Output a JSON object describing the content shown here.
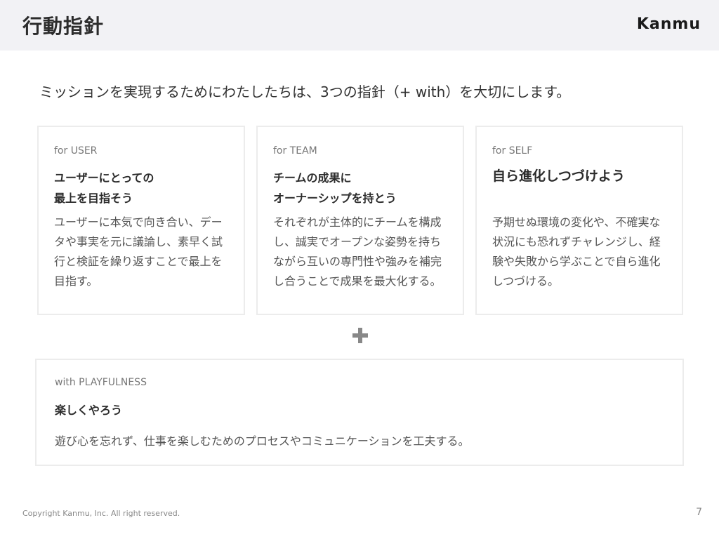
{
  "header": {
    "title": "行動指針",
    "logo": "Kanmu"
  },
  "intro": "ミッションを実現するためにわたしたちは、3つの指針（+ with）を大切にします。",
  "cards": [
    {
      "tag": "for USER",
      "heading_lines": [
        "ユーザーにとっての",
        "最上を目指そう"
      ],
      "body": "ユーザーに本気で向き合い、データや事実を元に議論し、素早く試行と検証を繰り返すことで最上を目指す。"
    },
    {
      "tag": "for TEAM",
      "heading_lines": [
        "チームの成果に",
        "オーナーシップを持とう"
      ],
      "body": "それぞれが主体的にチームを構成し、誠実でオープンな姿勢を持ちながら互いの専門性や強みを補完し合うことで成果を最大化する。"
    },
    {
      "tag": "for SELF",
      "heading_lines": [
        "自ら進化しつづけよう"
      ],
      "body": "予期せぬ環境の変化や、不確実な状況にも恐れずチャレンジし、経験や失敗から学ぶことで自ら進化しつづける。"
    }
  ],
  "plus_icon": "plus-icon",
  "playfulness": {
    "tag": "with PLAYFULNESS",
    "heading": "楽しくやろう",
    "body": "遊び心を忘れず、仕事を楽しむためのプロセスやコミュニケーションを工夫する。"
  },
  "footer": {
    "copyright": "Copyright Kanmu, Inc. All right reserved.",
    "page_number": "7"
  }
}
